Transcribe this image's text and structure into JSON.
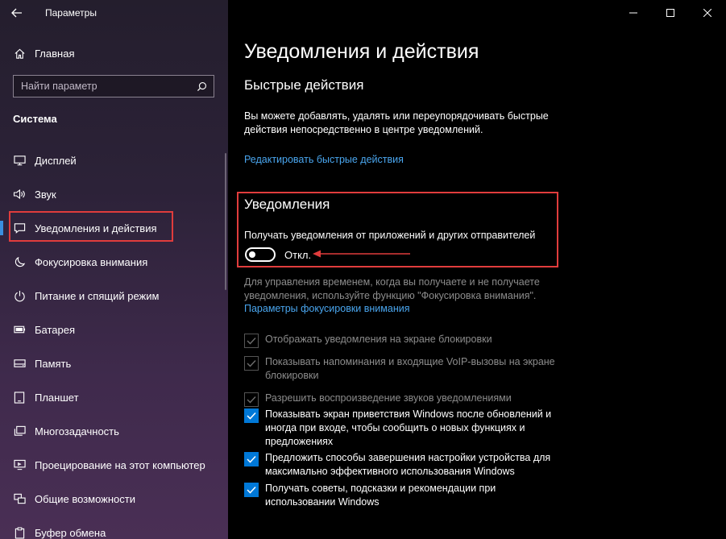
{
  "window": {
    "title": "Параметры"
  },
  "sidebar": {
    "home_label": "Главная",
    "search_placeholder": "Найти параметр",
    "section_title": "Система",
    "items": [
      {
        "label": "Дисплей",
        "icon": "display-icon"
      },
      {
        "label": "Звук",
        "icon": "speaker-icon"
      },
      {
        "label": "Уведомления и действия",
        "icon": "notification-icon",
        "active": true
      },
      {
        "label": "Фокусировка внимания",
        "icon": "moon-icon"
      },
      {
        "label": "Питание и спящий режим",
        "icon": "power-icon"
      },
      {
        "label": "Батарея",
        "icon": "battery-icon"
      },
      {
        "label": "Память",
        "icon": "storage-icon"
      },
      {
        "label": "Планшет",
        "icon": "tablet-icon"
      },
      {
        "label": "Многозадачность",
        "icon": "multitasking-icon"
      },
      {
        "label": "Проецирование на этот компьютер",
        "icon": "projection-icon"
      },
      {
        "label": "Общие возможности",
        "icon": "shared-icon"
      },
      {
        "label": "Буфер обмена",
        "icon": "clipboard-icon"
      }
    ]
  },
  "main": {
    "page_title": "Уведомления и действия",
    "quick_actions": {
      "heading": "Быстрые действия",
      "description": "Вы можете добавлять, удалять или переупорядочивать быстрые действия непосредственно в центре уведомлений.",
      "edit_link": "Редактировать быстрые действия"
    },
    "notifications": {
      "heading": "Уведомления",
      "toggle_caption": "Получать уведомления от приложений и других отправителей",
      "toggle_state": "Откл.",
      "focus_description": "Для управления временем, когда вы получаете и не получаете уведомления, используйте функцию \"Фокусировка внимания\".",
      "focus_link": "Параметры фокусировки внимания"
    },
    "checkboxes": [
      {
        "label": "Отображать уведомления на экране блокировки",
        "checked": true,
        "disabled": true
      },
      {
        "label": "Показывать напоминания и входящие VoIP-вызовы на экране блокировки",
        "checked": true,
        "disabled": true
      },
      {
        "label": "Разрешить  воспроизведение звуков уведомлениями",
        "checked": true,
        "disabled": true
      },
      {
        "label": "Показывать экран приветствия Windows после обновлений и иногда при входе, чтобы сообщить о новых функциях и предложениях",
        "checked": true,
        "disabled": false
      },
      {
        "label": "Предложить способы завершения настройки устройства для максимально эффективного использования Windows",
        "checked": true,
        "disabled": false
      },
      {
        "label": "Получать советы, подсказки и рекомендации при использовании Windows",
        "checked": true,
        "disabled": false
      }
    ]
  },
  "colors": {
    "accent": "#0078d7",
    "link": "#4aa6ef",
    "highlight": "#e03c3c"
  }
}
